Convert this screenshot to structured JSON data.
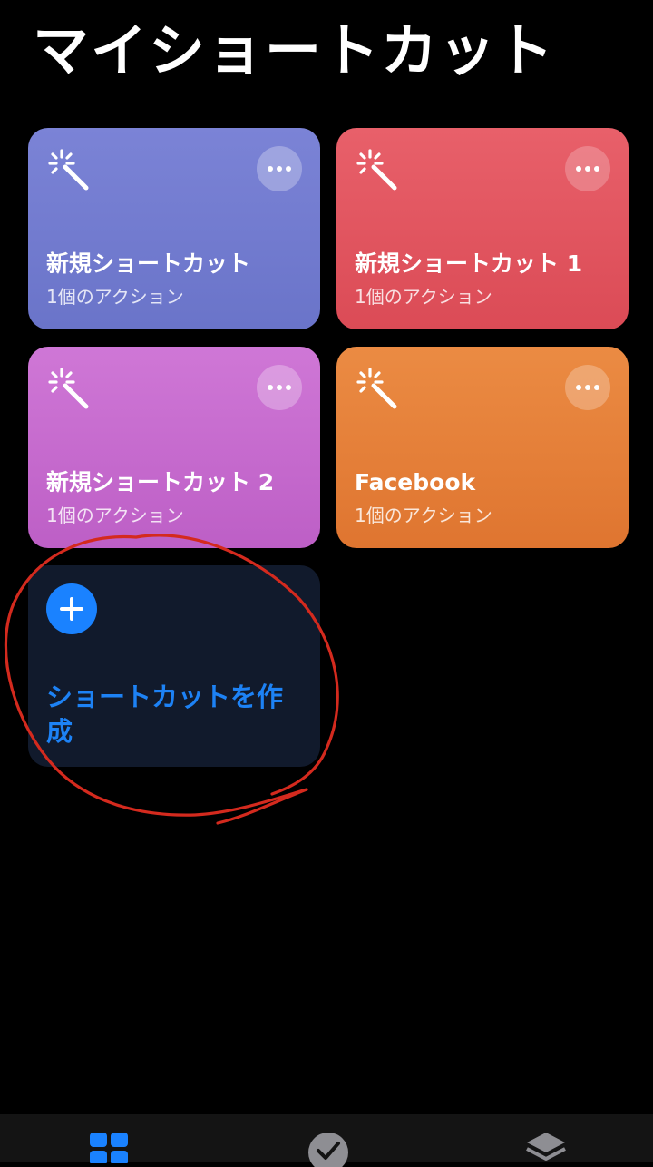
{
  "header": {
    "title": "マイショートカット"
  },
  "shortcuts": [
    {
      "name": "新規ショートカット",
      "subtitle": "1個のアクション",
      "color": "#6f79cd",
      "icon": "magic-wand-icon"
    },
    {
      "name": "新規ショートカット 1",
      "subtitle": "1個のアクション",
      "color": "#e0525d",
      "icon": "magic-wand-icon"
    },
    {
      "name": "新規ショートカット 2",
      "subtitle": "1個のアクション",
      "color": "#c568cd",
      "icon": "magic-wand-icon"
    },
    {
      "name": "Facebook",
      "subtitle": "1個のアクション",
      "color": "#e47c37",
      "icon": "magic-wand-icon"
    }
  ],
  "create_card": {
    "label": "ショートカットを作成",
    "icon": "plus-icon",
    "accent": "#1a82ff"
  },
  "annotation": {
    "color": "#d42a1e"
  },
  "tab_bar": {
    "tabs": [
      {
        "icon": "grid-icon",
        "active": true,
        "color": "#1a82ff"
      },
      {
        "icon": "checkmark-circle-icon",
        "active": false,
        "color": "#8e8e93"
      },
      {
        "icon": "stacked-layers-icon",
        "active": false,
        "color": "#8e8e93"
      }
    ]
  }
}
